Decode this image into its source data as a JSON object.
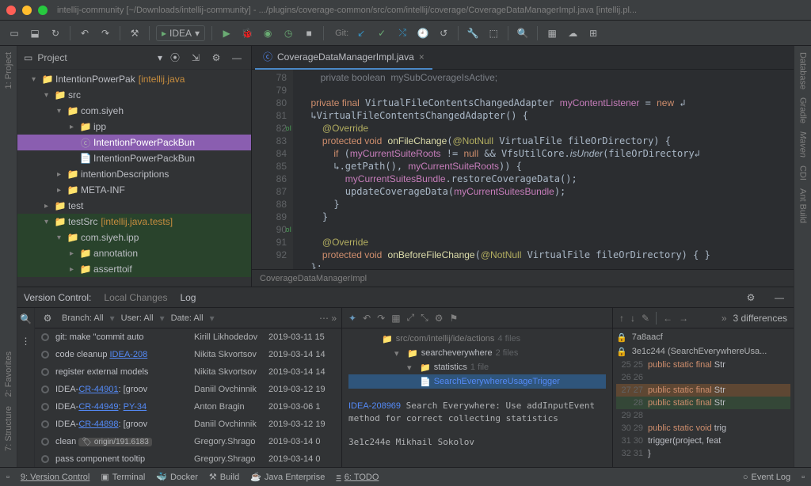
{
  "window": {
    "title": "intellij-community [~/Downloads/intellij-community] - .../plugins/coverage-common/src/com/intellij/coverage/CoverageDataManagerImpl.java [intellij.pl..."
  },
  "toolbar": {
    "run_config": "IDEA",
    "git_label": "Git:"
  },
  "left_gutter": [
    "1: Project",
    "2: Favorites",
    "7: Structure"
  ],
  "right_gutter": [
    "Database",
    "Gradle",
    "Maven",
    "CDI",
    "Ant Build"
  ],
  "project": {
    "title": "Project",
    "tree": [
      {
        "indent": 18,
        "arrow": "▾",
        "icon": "📁",
        "label": "IntentionPowerPak",
        "scope": "[intellij.java"
      },
      {
        "indent": 34,
        "arrow": "▾",
        "icon": "📁",
        "label": "src"
      },
      {
        "indent": 50,
        "arrow": "▾",
        "icon": "📁",
        "label": "com.siyeh"
      },
      {
        "indent": 66,
        "arrow": "▸",
        "icon": "📁",
        "label": "ipp"
      },
      {
        "indent": 66,
        "arrow": "",
        "icon": "ⓒ",
        "label": "IntentionPowerPackBun",
        "selected": true
      },
      {
        "indent": 66,
        "arrow": "",
        "icon": "📄",
        "label": "IntentionPowerPackBun"
      },
      {
        "indent": 50,
        "arrow": "▸",
        "icon": "📁",
        "label": "intentionDescriptions"
      },
      {
        "indent": 50,
        "arrow": "▸",
        "icon": "📁",
        "label": "META-INF"
      },
      {
        "indent": 34,
        "arrow": "▸",
        "icon": "📁",
        "label": "test"
      },
      {
        "indent": 34,
        "arrow": "▾",
        "icon": "📁",
        "label": "testSrc",
        "scope": "[intellij.java.tests]",
        "test": true
      },
      {
        "indent": 50,
        "arrow": "▾",
        "icon": "📁",
        "label": "com.siyeh.ipp",
        "test": true
      },
      {
        "indent": 66,
        "arrow": "▸",
        "icon": "📁",
        "label": "annotation",
        "test": true
      },
      {
        "indent": 66,
        "arrow": "▸",
        "icon": "📁",
        "label": "asserttoif",
        "test": true
      }
    ]
  },
  "editor": {
    "tab": "CoverageDataManagerImpl.java",
    "lines": [
      "78",
      "79",
      "80",
      "81",
      "82",
      "83",
      "84",
      "85",
      "86",
      "87",
      "88",
      "89",
      "90",
      "91",
      "92"
    ],
    "breadcrumb": "CoverageDataManagerImpl"
  },
  "vc": {
    "title": "Version Control:",
    "tabs": [
      "Local Changes",
      "Log"
    ],
    "active_tab": "Log",
    "filters": {
      "branch": "Branch: All",
      "user": "User: All",
      "date": "Date: All"
    },
    "commits": [
      {
        "msg": "git: make \"commit auto",
        "author": "Kirill Likhodedov",
        "date": "2019-03-11 15"
      },
      {
        "msg": "code cleanup ",
        "link": "IDEA-208",
        "author": "Nikita Skvortsov",
        "date": "2019-03-14 14"
      },
      {
        "msg": "register external models",
        "author": "Nikita Skvortsov",
        "date": "2019-03-14 14"
      },
      {
        "msg": "IDEA-",
        "link": "CR-44901",
        "tail": ": [groov",
        "author": "Daniil Ovchinnik",
        "date": "2019-03-12 19"
      },
      {
        "msg": "IDEA-",
        "link": "CR-44949",
        "tail2": "PY-34",
        "author": "Anton Bragin",
        "date": "2019-03-06 1"
      },
      {
        "msg": "IDEA-",
        "link": "CR-44898",
        "tail": ": [groov",
        "author": "Daniil Ovchinnik",
        "date": "2019-03-12 19"
      },
      {
        "msg": "clean ",
        "tag": "origin/191.6183",
        "author": "Gregory.Shrago",
        "date": "2019-03-14 0"
      },
      {
        "msg": "pass component tooltip",
        "author": "Gregory.Shrago",
        "date": "2019-03-14 0"
      }
    ],
    "mid": {
      "tree": [
        {
          "indent": 42,
          "label": "src/com/intellij/ide/actions",
          "suffix": "4 files",
          "dim": true
        },
        {
          "indent": 58,
          "arrow": "▾",
          "label": "searcheverywhere",
          "suffix": "2 files"
        },
        {
          "indent": 74,
          "arrow": "▾",
          "label": "statistics",
          "suffix": "1 file"
        },
        {
          "indent": 90,
          "label": "SearchEverywhereUsageTrigger",
          "sel": true,
          "file": true
        }
      ],
      "detail_link": "IDEA-208969",
      "detail_text": " Search Everywhere: Use addInputEvent method for correct collecting statistics",
      "hash": "3e1c244e Mikhail Sokolov"
    },
    "diff": {
      "diff_label": "3 differences",
      "branch1": "7a8aacf",
      "branch2": "3e1c244 (SearchEverywhereUsa...",
      "rows": [
        {
          "l": "25",
          "r": "25",
          "code": "public static final Str"
        },
        {
          "l": "26",
          "r": "26",
          "code": ""
        },
        {
          "l": "27",
          "r": "27",
          "code": "public static final Str",
          "hl": "orange"
        },
        {
          "l": "",
          "r": "28",
          "code": "public static final Str",
          "hl": "green"
        },
        {
          "l": "29",
          "r": "28",
          "code": ""
        },
        {
          "l": "30",
          "r": "29",
          "code": "public static void trig"
        },
        {
          "l": "31",
          "r": "30",
          "code": "  trigger(project, feat"
        },
        {
          "l": "32",
          "r": "31",
          "code": "}"
        }
      ]
    },
    "gear": "⚙"
  },
  "statusbar": {
    "items": [
      "9: Version Control",
      "Terminal",
      "Docker",
      "Build",
      "Java Enterprise",
      "6: TODO"
    ],
    "event_log": "Event Log"
  }
}
